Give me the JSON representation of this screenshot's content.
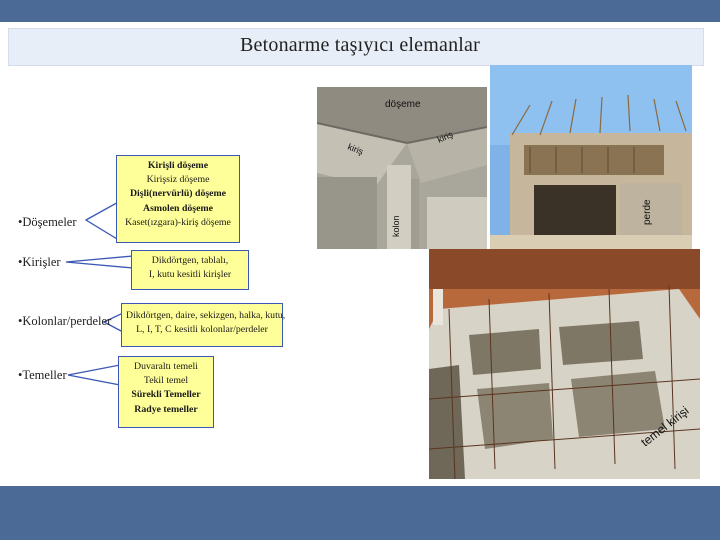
{
  "slide": {
    "title": "Betonarme taşıyıcı elemanlar",
    "colors": {
      "bar": "#4b6a95",
      "title_band": "#e8eef8",
      "box_fill": "#ffff99",
      "box_border": "#3b58b5"
    }
  },
  "categories": [
    {
      "bullet": "•Döşemeler",
      "items": [
        "Kirişli döşeme",
        "Kirişsiz döşeme",
        "Dişli(nervürlü) döşeme",
        "Asmolen döşeme",
        "Kaset(ızgara)-kiriş döşeme"
      ]
    },
    {
      "bullet": "•Kirişler",
      "items": [
        "Dikdörtgen, tablalı,",
        "I, kutu kesitli kirişler"
      ]
    },
    {
      "bullet": "•Kolonlar/perdeler",
      "items": [
        "Dikdörtgen, daire, sekizgen, halka, kutu,",
        "L, I, T, C kesitli kolonlar/perdeler"
      ]
    },
    {
      "bullet": "•Temeller",
      "items": [
        "Duvaraltı temeli",
        "Tekil temel",
        "Sürekli Temeller",
        "Radye temeller"
      ]
    }
  ],
  "photos": {
    "photo1": {
      "labels": [
        "döşeme",
        "kiriş",
        "kiriş",
        "kolon"
      ]
    },
    "photo2": {
      "labels": [
        "perde"
      ]
    },
    "photo3": {
      "labels": [
        "temel kirişi"
      ]
    }
  }
}
